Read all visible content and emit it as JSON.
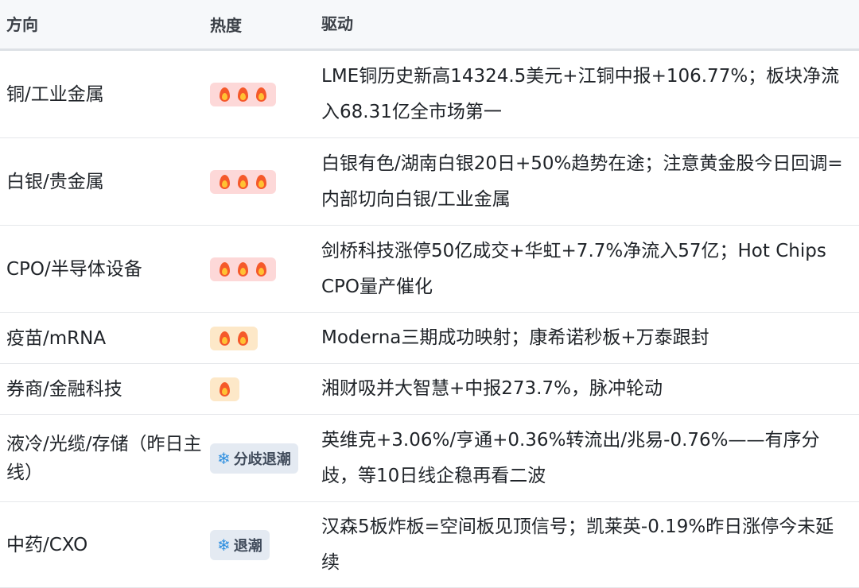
{
  "header": {
    "direction": "方向",
    "heat": "热度",
    "driver": "驱动"
  },
  "rows": [
    {
      "direction": "铜/工业金属",
      "heat_level": 3,
      "driver": "LME铜历史新高14324.5美元+江铜中报+106.77%；板块净流入68.31亿全市场第一"
    },
    {
      "direction": "白银/贵金属",
      "heat_level": 3,
      "driver": "白银有色/湖南白银20日+50%趋势在途；注意黄金股今日回调=内部切向白银/工业金属"
    },
    {
      "direction": "CPO/半导体设备",
      "heat_level": 3,
      "driver": "剑桥科技涨停50亿成交+华虹+7.7%净流入57亿；Hot Chips CPO量产催化"
    },
    {
      "direction": "疫苗/mRNA",
      "heat_level": 2,
      "driver": "Moderna三期成功映射；康希诺秒板+万泰跟封"
    },
    {
      "direction": "券商/金融科技",
      "heat_level": 1,
      "driver": "湘财吸并大智慧+中报273.7%，脉冲轮动"
    },
    {
      "direction": "液冷/光缆/存储（昨日主线）",
      "badge_text": "分歧退潮",
      "driver": "英维克+3.06%/亨通+0.36%转流出/兆易-0.76%——有序分歧，等10日线企稳再看二波"
    },
    {
      "direction": "中药/CXO",
      "badge_text": "退潮",
      "driver": "汉森5板炸板=空间板见顶信号；凯莱英-0.19%昨日涨停今未延续"
    }
  ],
  "icons": {
    "flame": "fire-icon",
    "snow": "snowflake-icon"
  },
  "colors": {
    "hot_bg": "#fdd8d8",
    "warm_bg": "#fde8c8",
    "cool_bg": "#e4eaf2",
    "flame": "#f5592a",
    "snow": "#2e8fe0"
  }
}
